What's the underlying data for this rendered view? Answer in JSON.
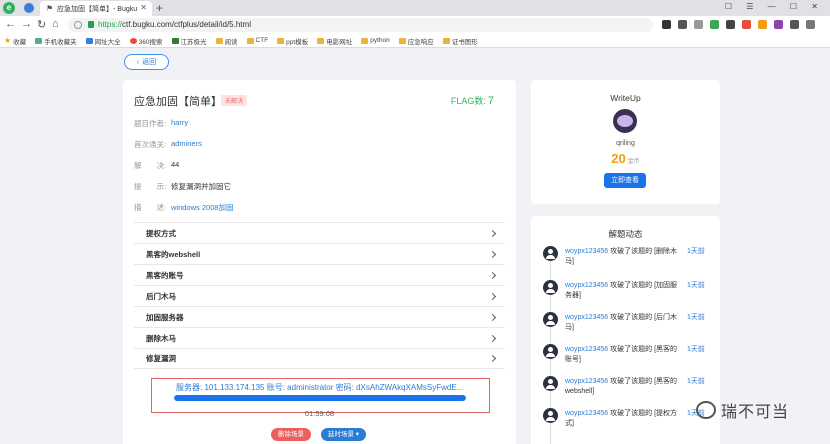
{
  "browser": {
    "tab_title": "应急加固【简单】- Bugku C",
    "url_scheme": "https://",
    "url_rest": "ctf.bugku.com/ctfplus/detail/id/5.html",
    "bookmarks": [
      "收藏",
      "手机收藏夹",
      "网址大全",
      "360搜索",
      "江苏极光",
      "阅读",
      "CTF",
      "ppt模板",
      "电影网址",
      "python",
      "应急响应",
      "证书图形"
    ]
  },
  "page": {
    "back_label": "返回",
    "challenge_title": "应急加固【简单】",
    "status_badge": "未解决",
    "flag_label": "FLAG数:",
    "flag_count": "7",
    "info": {
      "author_label": "题目作者:",
      "author": "harry",
      "first_blood_label": "首次通关:",
      "first_blood": "adminers",
      "solves_label": "解　　决:",
      "solves": "44",
      "hint_label": "提　　示:",
      "hint": "修复漏洞并加固它",
      "desc_label": "描　　述:",
      "desc": "windows 2008加固"
    },
    "tasks": [
      "提权方式",
      "黑客的webshell",
      "黑客的账号",
      "后门木马",
      "加固服务器",
      "删除木马",
      "修复漏洞"
    ],
    "server_text": "服务器: 101.133.174.135 账号: administrator 密码: dXsAhZWAkqXAMsSyFwdE...",
    "progress_fraction": 1.0,
    "timer": "01:59:08",
    "destroy_label": "删除场景",
    "renew_label": "延时场景 ▾"
  },
  "writeup": {
    "title": "WriteUp",
    "author": "qriling",
    "coins": "20",
    "coins_unit": "金币",
    "view_label": "立即查看"
  },
  "solves": {
    "title": "解题动态",
    "items": [
      {
        "user": "woypx123456",
        "text": "攻破了该题的 [删除木马]",
        "time": "1天前"
      },
      {
        "user": "woypx123456",
        "text": "攻破了该题的 [加固服务器]",
        "time": "1天前"
      },
      {
        "user": "woypx123456",
        "text": "攻破了该题的 [后门木马]",
        "time": "1天前"
      },
      {
        "user": "woypx123456",
        "text": "攻破了该题的 [黑客的账号]",
        "time": "1天前"
      },
      {
        "user": "woypx123456",
        "text": "攻破了该题的 [黑客的webshell]",
        "time": "1天前"
      },
      {
        "user": "woypx123456",
        "text": "攻破了该题的 [提权方式]",
        "time": "1天前"
      }
    ]
  },
  "watermark": "瑞不可当"
}
